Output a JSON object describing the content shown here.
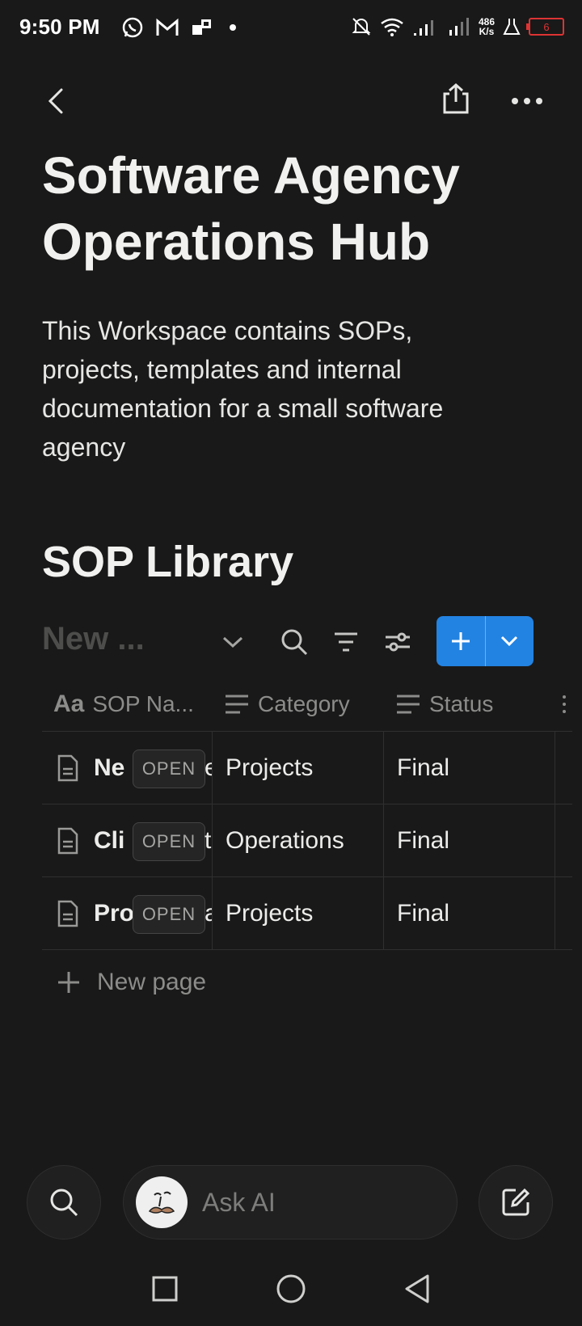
{
  "status_bar": {
    "time": "9:50 PM",
    "net_speed_value": "486",
    "net_speed_unit": "K/s",
    "battery_level": "6",
    "icons": [
      "whatsapp-icon",
      "gmail-icon",
      "chat-icon",
      "notification-dot-icon",
      "mute-icon",
      "wifi-icon",
      "signal-icon",
      "signal-icon",
      "lab-icon",
      "battery-icon"
    ]
  },
  "top_nav": {
    "icons": [
      "back-icon",
      "share-icon",
      "more-icon"
    ]
  },
  "page": {
    "title": "Software Agency Operations Hub",
    "description": "This Workspace contains SOPs, projects, templates and internal documentation for a small software agency"
  },
  "database": {
    "section_title": "SOP Library",
    "view_name": "New ...",
    "toolbar_icons": [
      "chevron-down-icon",
      "search-icon",
      "filter-icon",
      "settings-sliders-icon"
    ],
    "new_button_icons": [
      "plus-icon",
      "chevron-down-icon"
    ],
    "columns": [
      {
        "label": "SOP Na...",
        "icon": "title-type-icon"
      },
      {
        "label": "Category",
        "icon": "text-type-icon"
      },
      {
        "label": "Status",
        "icon": "text-type-icon"
      }
    ],
    "rows": [
      {
        "name": "Ne",
        "tail": "e",
        "category": "Projects",
        "status": "Final",
        "open_label": "OPEN"
      },
      {
        "name": "Cli",
        "tail": "t",
        "category": "Operations",
        "status": "Final",
        "open_label": "OPEN"
      },
      {
        "name": "Pro",
        "tail": "a",
        "category": "Projects",
        "status": "Final",
        "open_label": "OPEN"
      }
    ],
    "new_page_label": "New page"
  },
  "bottom_bar": {
    "ask_ai_placeholder": "Ask AI",
    "icons": [
      "search-icon",
      "ai-avatar-icon",
      "compose-icon"
    ]
  },
  "system_nav": {
    "icons": [
      "recents-icon",
      "home-icon",
      "back-triangle-icon"
    ]
  },
  "colors": {
    "background": "#191919",
    "accent": "#2383e2",
    "battery_low": "#dd3333"
  }
}
